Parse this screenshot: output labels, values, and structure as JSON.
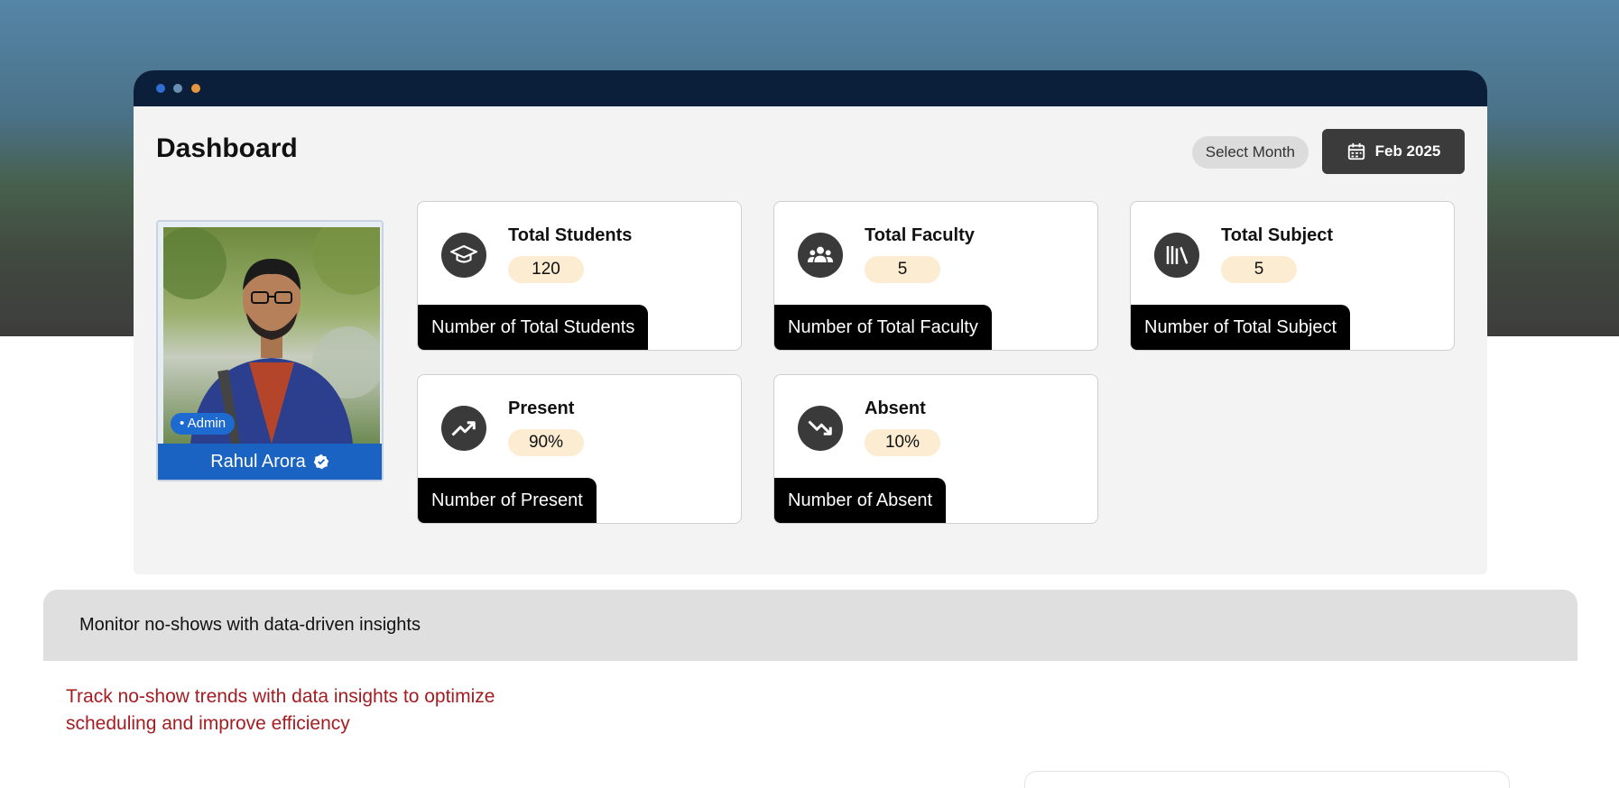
{
  "header": {
    "title": "Dashboard",
    "select_month_label": "Select Month",
    "date_label": "Feb 2025"
  },
  "profile": {
    "name": "Rahul Arora",
    "role": "• Admin"
  },
  "stats": [
    {
      "title": "Total Students",
      "value": "120",
      "footer": "Number of Total Students",
      "icon": "graduation-cap-icon"
    },
    {
      "title": "Total Faculty",
      "value": "5",
      "footer": "Number of Total Faculty",
      "icon": "users-icon"
    },
    {
      "title": "Total Subject",
      "value": "5",
      "footer": "Number of Total Subject",
      "icon": "books-icon"
    },
    {
      "title": "Present",
      "value": "90%",
      "footer": "Number of Present",
      "icon": "trend-up-icon"
    },
    {
      "title": "Absent",
      "value": "10%",
      "footer": "Number of Absent",
      "icon": "trend-down-icon"
    }
  ],
  "section": {
    "heading": "Monitor no-shows with data-driven insights",
    "description": "Track no-show trends with data insights to optimize scheduling and improve efficiency"
  },
  "colors": {
    "window_bar": "#0b1f3a",
    "accent_blue": "#1b63c2",
    "value_pill": "#fbecd2",
    "insight_text": "#a31d22"
  }
}
